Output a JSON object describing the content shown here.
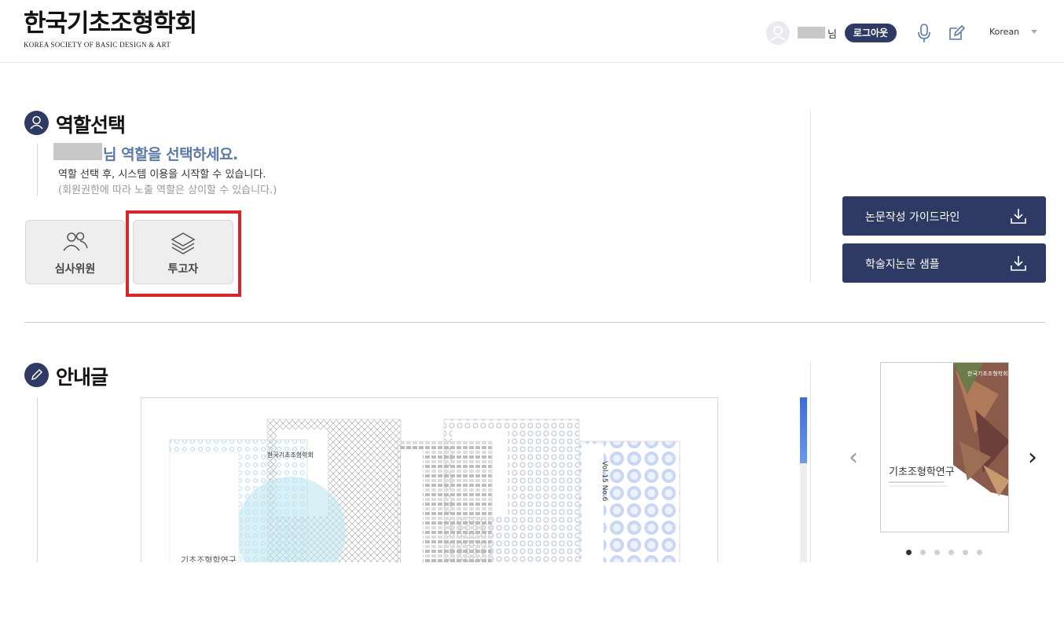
{
  "header": {
    "logo_kr": "한국기초조형학회",
    "logo_en": "KOREA SOCIETY OF BASIC DESIGN & ART",
    "user_suffix": "님",
    "logout_label": "로그아웃",
    "language": "Korean"
  },
  "role_section": {
    "title": "역할선택",
    "heading": "님 역할을 선택하세요.",
    "desc1": "역할 선택 후, 시스템 이용을 시작할 수 있습니다.",
    "desc2": "(회원권한에 따라 노출 역할은 상이할 수 있습니다.)",
    "roles": [
      {
        "label": "심사위원",
        "icon": "users-icon"
      },
      {
        "label": "투고자",
        "icon": "layers-icon"
      }
    ],
    "selected_role": "투고자"
  },
  "downloads": [
    {
      "label": "논문작성 가이드라인",
      "icon": "download-icon"
    },
    {
      "label": "학술지논문 샘플",
      "icon": "download-icon"
    }
  ],
  "notice_section": {
    "title": "안내글",
    "cover_texts": {
      "journal_kr": "기초조형학연구",
      "vol": "Vol.15 No.6",
      "society": "한국기초조형학회"
    }
  },
  "carousel": {
    "journal_kr": "기초조형학연구",
    "society": "한국기초조형학회",
    "dot_count": 6,
    "active_index": 0
  },
  "colors": {
    "navy": "#2e3a63",
    "heading_blue": "#5a78a8",
    "highlight_red": "#d6262c"
  }
}
